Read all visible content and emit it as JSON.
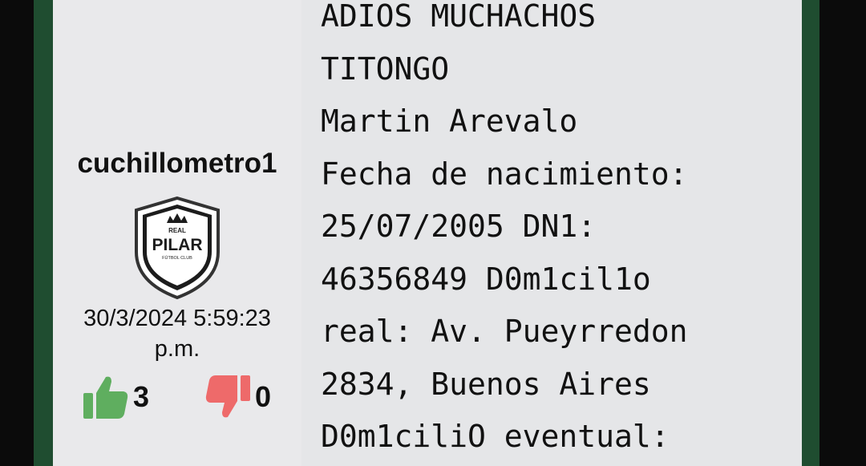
{
  "post": {
    "author": "cuchillometro1",
    "badge": {
      "top_text": "REAL",
      "name": "PILAR",
      "sub_text": "FÚTBOL CLUB"
    },
    "timestamp_line1": "30/3/2024 5:59:23",
    "timestamp_line2": "p.m.",
    "likes": "3",
    "dislikes": "0",
    "message_lines": [
      "ADIOS MUCHACHOS",
      "TITONGO",
      "Martin Arevalo",
      "Fecha de nacimiento:",
      "25/07/2005 DN1:",
      "46356849 D0m1cil1o",
      "real: Av. Pueyrredon",
      "2834, Buenos Aires",
      "D0m1ciliO eventual:"
    ]
  },
  "colors": {
    "like": "#5fae5f",
    "dislike": "#ee6a6a",
    "frame_green": "#1f4d30",
    "card_bg": "#e5e6e8"
  }
}
